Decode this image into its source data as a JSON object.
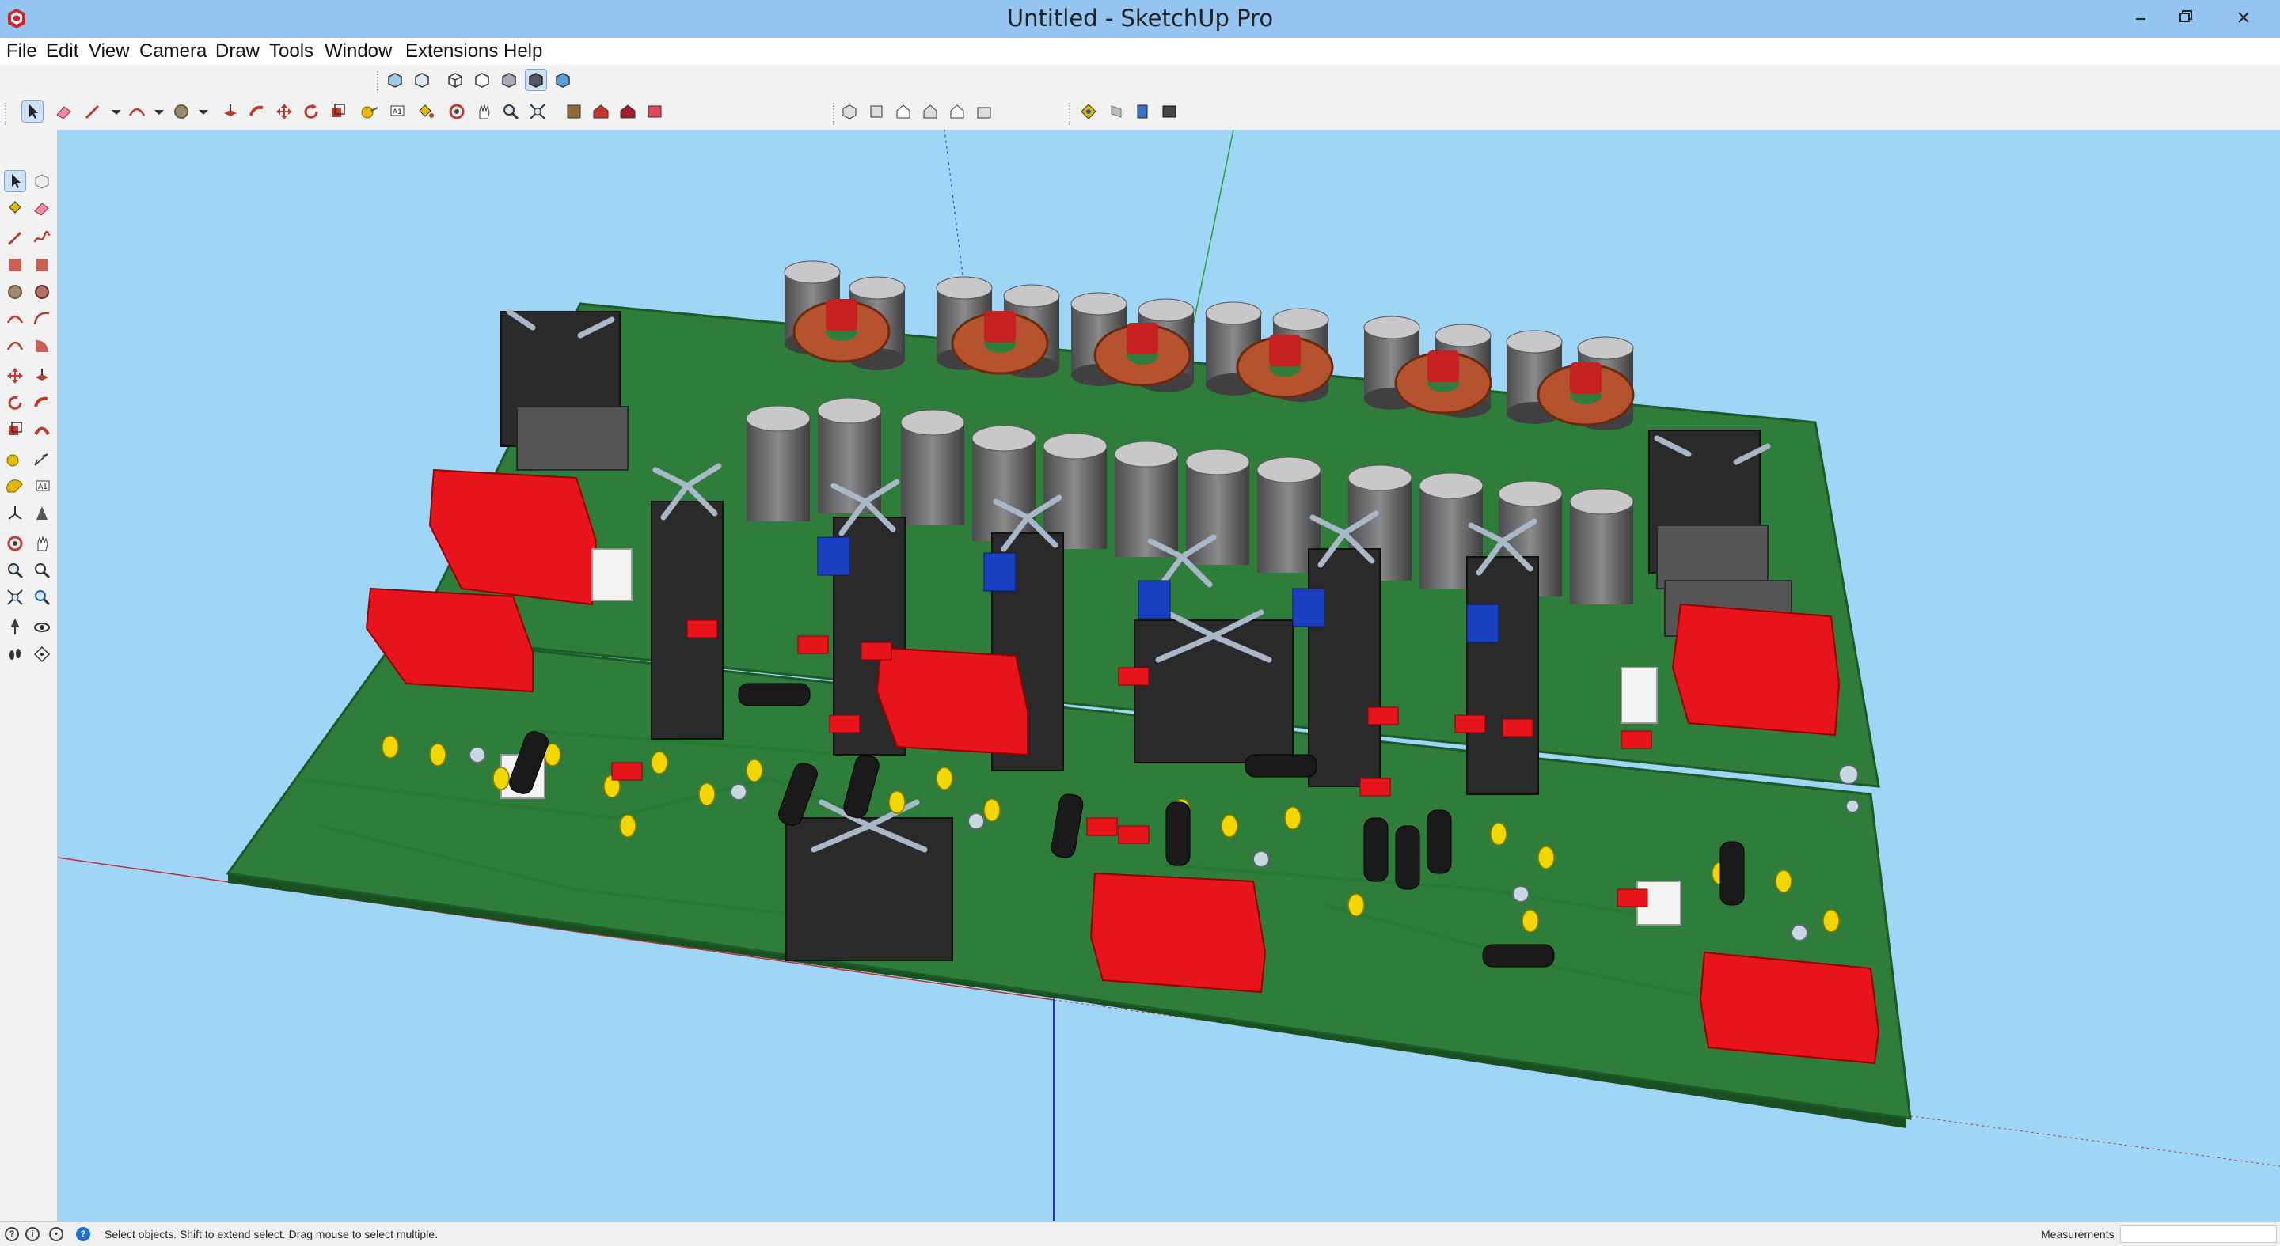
{
  "window": {
    "title": "Untitled - SketchUp Pro"
  },
  "menu": [
    "File",
    "Edit",
    "View",
    "Camera",
    "Draw",
    "Tools",
    "Window",
    "Extensions",
    "Help"
  ],
  "toolbar_icons": [
    "select",
    "eraser",
    "pencil-line",
    "arc",
    "circle",
    "push-pull",
    "follow-me",
    "move",
    "rotate",
    "scale",
    "tape",
    "text",
    "paint",
    "orbit",
    "pan",
    "zoom",
    "zoom-extents",
    "components",
    "warehouse",
    "extension-warehouse",
    "send-to-layout"
  ],
  "view_icons": [
    "iso",
    "top",
    "front",
    "right",
    "back",
    "left"
  ],
  "style_icons": [
    "xray",
    "back-edges",
    "wireframe",
    "hidden-line",
    "shaded",
    "shaded-textures",
    "monochrome"
  ],
  "status": {
    "text": "Select objects. Shift to extend select. Drag mouse to select multiple.",
    "measurements_label": "Measurements",
    "measurements_value": ""
  },
  "colors": {
    "sky": "#9fd6f7",
    "pcb": "#2e7d3a",
    "capacitor_red": "#e8141c",
    "heatsink": "#2b2b2b",
    "electrolytic": "#6e6e70",
    "pad": "#f2d600"
  }
}
